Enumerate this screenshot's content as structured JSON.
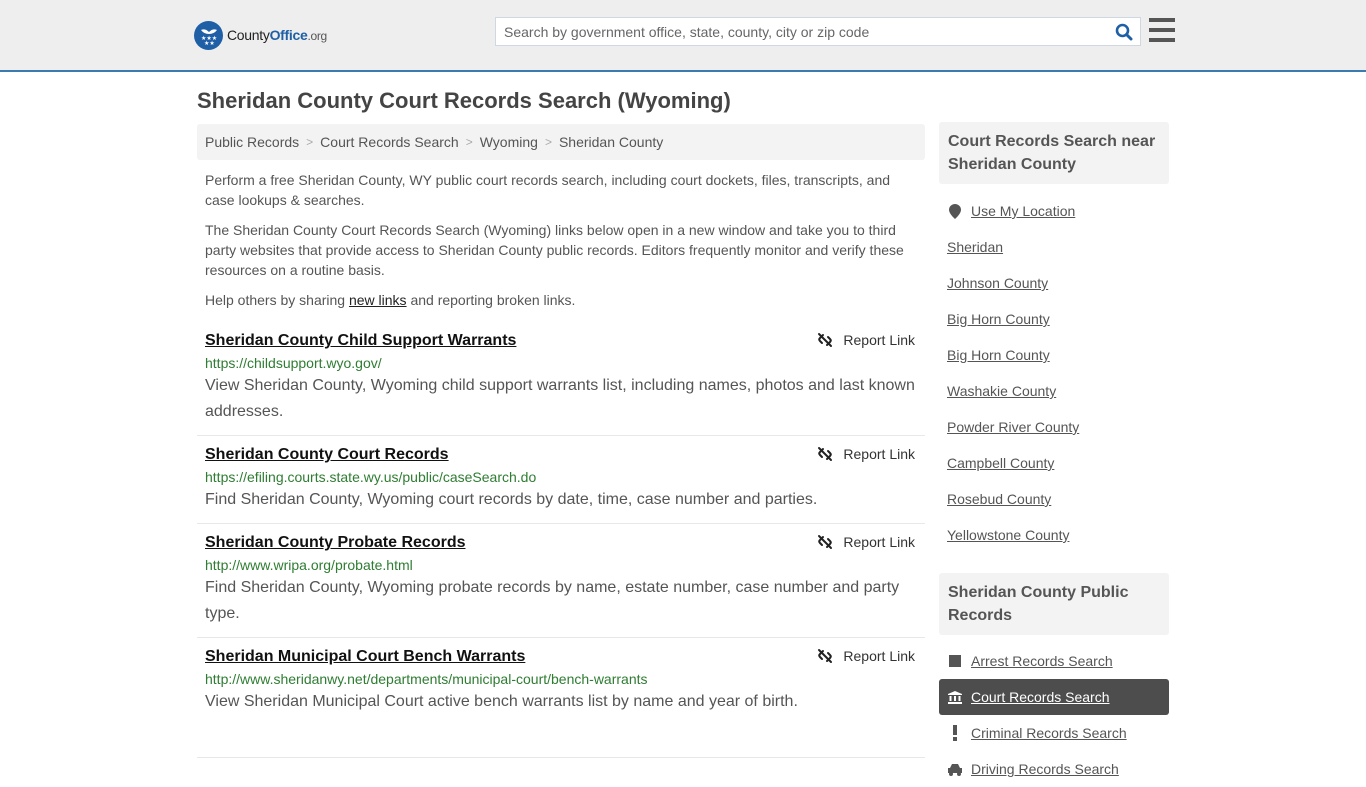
{
  "header": {
    "logo": {
      "brand_a": "County",
      "brand_b": "Office",
      "tld": ".org"
    },
    "search": {
      "placeholder": "Search by government office, state, county, city or zip code",
      "value": ""
    },
    "icons": {
      "search": "search-icon",
      "menu": "hamburger-menu-icon"
    },
    "accent_color": "#3a7bb0",
    "brand_color": "#1f5fa6"
  },
  "page": {
    "title": "Sheridan County Court Records Search (Wyoming)",
    "breadcrumb": [
      {
        "label": "Public Records"
      },
      {
        "label": "Court Records Search"
      },
      {
        "label": "Wyoming"
      },
      {
        "label": "Sheridan County"
      }
    ],
    "breadcrumb_separator": ">",
    "intro": {
      "p1": "Perform a free Sheridan County, WY public court records search, including court dockets, files, transcripts, and case lookups & searches.",
      "p2": "The Sheridan County Court Records Search (Wyoming) links below open in a new window and take you to third party websites that provide access to Sheridan County public records. Editors frequently monitor and verify these resources on a routine basis.",
      "p3_before": "Help others by sharing ",
      "p3_link": "new links",
      "p3_after": " and reporting broken links."
    }
  },
  "results": [
    {
      "title": "Sheridan County Child Support Warrants",
      "url": "https://childsupport.wyo.gov/",
      "description": "View Sheridan County, Wyoming child support warrants list, including names, photos and last known addresses.",
      "report_label": "Report Link"
    },
    {
      "title": "Sheridan County Court Records",
      "url": "https://efiling.courts.state.wy.us/public/caseSearch.do",
      "description": "Find Sheridan County, Wyoming court records by date, time, case number and parties.",
      "report_label": "Report Link"
    },
    {
      "title": "Sheridan County Probate Records",
      "url": "http://www.wripa.org/probate.html",
      "description": "Find Sheridan County, Wyoming probate records by name, estate number, case number and party type.",
      "report_label": "Report Link"
    },
    {
      "title": "Sheridan Municipal Court Bench Warrants",
      "url": "http://www.sheridanwy.net/departments/municipal-court/bench-warrants",
      "description": "View Sheridan Municipal Court active bench warrants list by name and year of birth.",
      "report_label": "Report Link"
    }
  ],
  "sidebar": {
    "nearby": {
      "heading": "Court Records Search near Sheridan County",
      "use_location": "Use My Location",
      "items": [
        {
          "label": "Sheridan"
        },
        {
          "label": "Johnson County"
        },
        {
          "label": "Big Horn County"
        },
        {
          "label": "Big Horn County"
        },
        {
          "label": "Washakie County"
        },
        {
          "label": "Powder River County"
        },
        {
          "label": "Campbell County"
        },
        {
          "label": "Rosebud County"
        },
        {
          "label": "Yellowstone County"
        }
      ]
    },
    "public_records": {
      "heading": "Sheridan County Public Records",
      "items": [
        {
          "label": "Arrest Records Search",
          "icon": "square-icon",
          "active": false
        },
        {
          "label": "Court Records Search",
          "icon": "courthouse-icon",
          "active": true
        },
        {
          "label": "Criminal Records Search",
          "icon": "exclamation-icon",
          "active": false
        },
        {
          "label": "Driving Records Search",
          "icon": "car-icon",
          "active": false
        }
      ]
    }
  }
}
